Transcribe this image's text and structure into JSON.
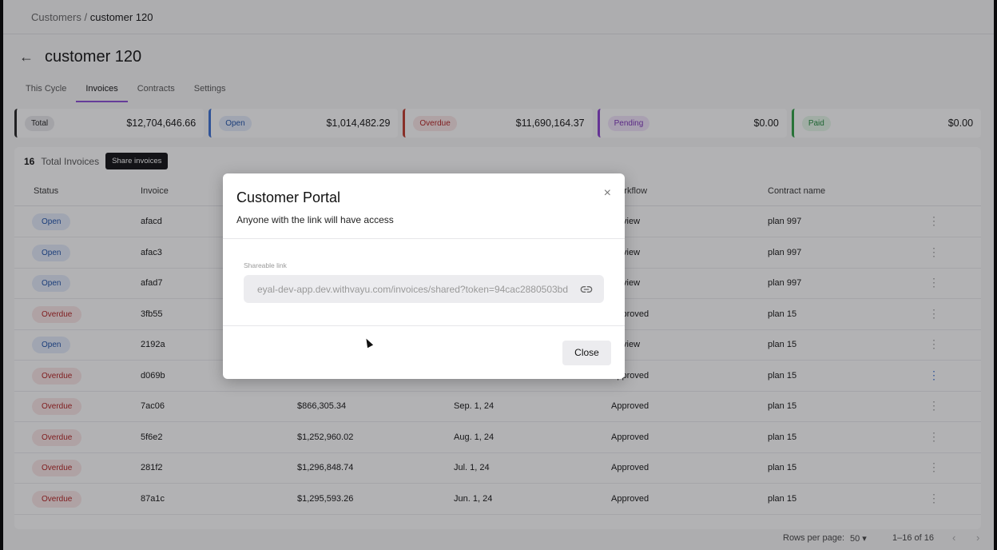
{
  "breadcrumb": {
    "parent": "Customers",
    "separator": "/",
    "current": "customer 120"
  },
  "page": {
    "title": "customer 120",
    "back_icon": "arrow-left-icon"
  },
  "tabs": [
    {
      "label": "This Cycle",
      "active": false
    },
    {
      "label": "Invoices",
      "active": true
    },
    {
      "label": "Contracts",
      "active": false
    },
    {
      "label": "Settings",
      "active": false
    }
  ],
  "stats": [
    {
      "label": "Total",
      "value": "$12,704,646.66",
      "color": "#222222"
    },
    {
      "label": "Open",
      "value": "$1,014,482.29",
      "color": "#3b6fd4"
    },
    {
      "label": "Overdue",
      "value": "$11,690,164.37",
      "color": "#c0392b"
    },
    {
      "label": "Pending",
      "value": "$0.00",
      "color": "#8a3fd0"
    },
    {
      "label": "Paid",
      "value": "$0.00",
      "color": "#2ea043"
    }
  ],
  "invoices": {
    "count": "16",
    "count_label": "Total Invoices",
    "share_button": "Share invoices",
    "columns": [
      "Status",
      "Invoice",
      "",
      "",
      "Workflow",
      "Contract name"
    ],
    "rows": [
      {
        "status": "Open",
        "invoice": "afacd",
        "amount": "",
        "date": "",
        "workflow": "Review",
        "contract": "plan 997"
      },
      {
        "status": "Open",
        "invoice": "afac3",
        "amount": "",
        "date": "",
        "workflow": "Review",
        "contract": "plan 997"
      },
      {
        "status": "Open",
        "invoice": "afad7",
        "amount": "",
        "date": "",
        "workflow": "Review",
        "contract": "plan 997"
      },
      {
        "status": "Overdue",
        "invoice": "3fb55",
        "amount": "",
        "date": "",
        "workflow": "Approved",
        "contract": "plan 15"
      },
      {
        "status": "Open",
        "invoice": "2192a",
        "amount": "",
        "date": "",
        "workflow": "Review",
        "contract": "plan 15"
      },
      {
        "status": "Overdue",
        "invoice": "d069b",
        "amount": "",
        "date": "",
        "workflow": "Approved",
        "contract": "plan 15"
      },
      {
        "status": "Overdue",
        "invoice": "7ac06",
        "amount": "$866,305.34",
        "date": "Sep. 1, 24",
        "workflow": "Approved",
        "contract": "plan 15"
      },
      {
        "status": "Overdue",
        "invoice": "5f6e2",
        "amount": "$1,252,960.02",
        "date": "Aug. 1, 24",
        "workflow": "Approved",
        "contract": "plan 15"
      },
      {
        "status": "Overdue",
        "invoice": "281f2",
        "amount": "$1,296,848.74",
        "date": "Jul. 1, 24",
        "workflow": "Approved",
        "contract": "plan 15"
      },
      {
        "status": "Overdue",
        "invoice": "87a1c",
        "amount": "$1,295,593.26",
        "date": "Jun. 1, 24",
        "workflow": "Approved",
        "contract": "plan 15"
      }
    ]
  },
  "pagination": {
    "rows_per_page_label": "Rows per page:",
    "rows_per_page": "50 ▾",
    "range": "1–16 of 16",
    "prev": "‹",
    "next": "›"
  },
  "modal": {
    "title": "Customer Portal",
    "subtitle": "Anyone with the link will have access",
    "close_icon": "×",
    "field_label": "Shareable link",
    "link_value": "eyal-dev-app.dev.withvayu.com/invoices/shared?token=94cac2880503bd",
    "copy_icon": "link-icon",
    "close_button": "Close"
  }
}
